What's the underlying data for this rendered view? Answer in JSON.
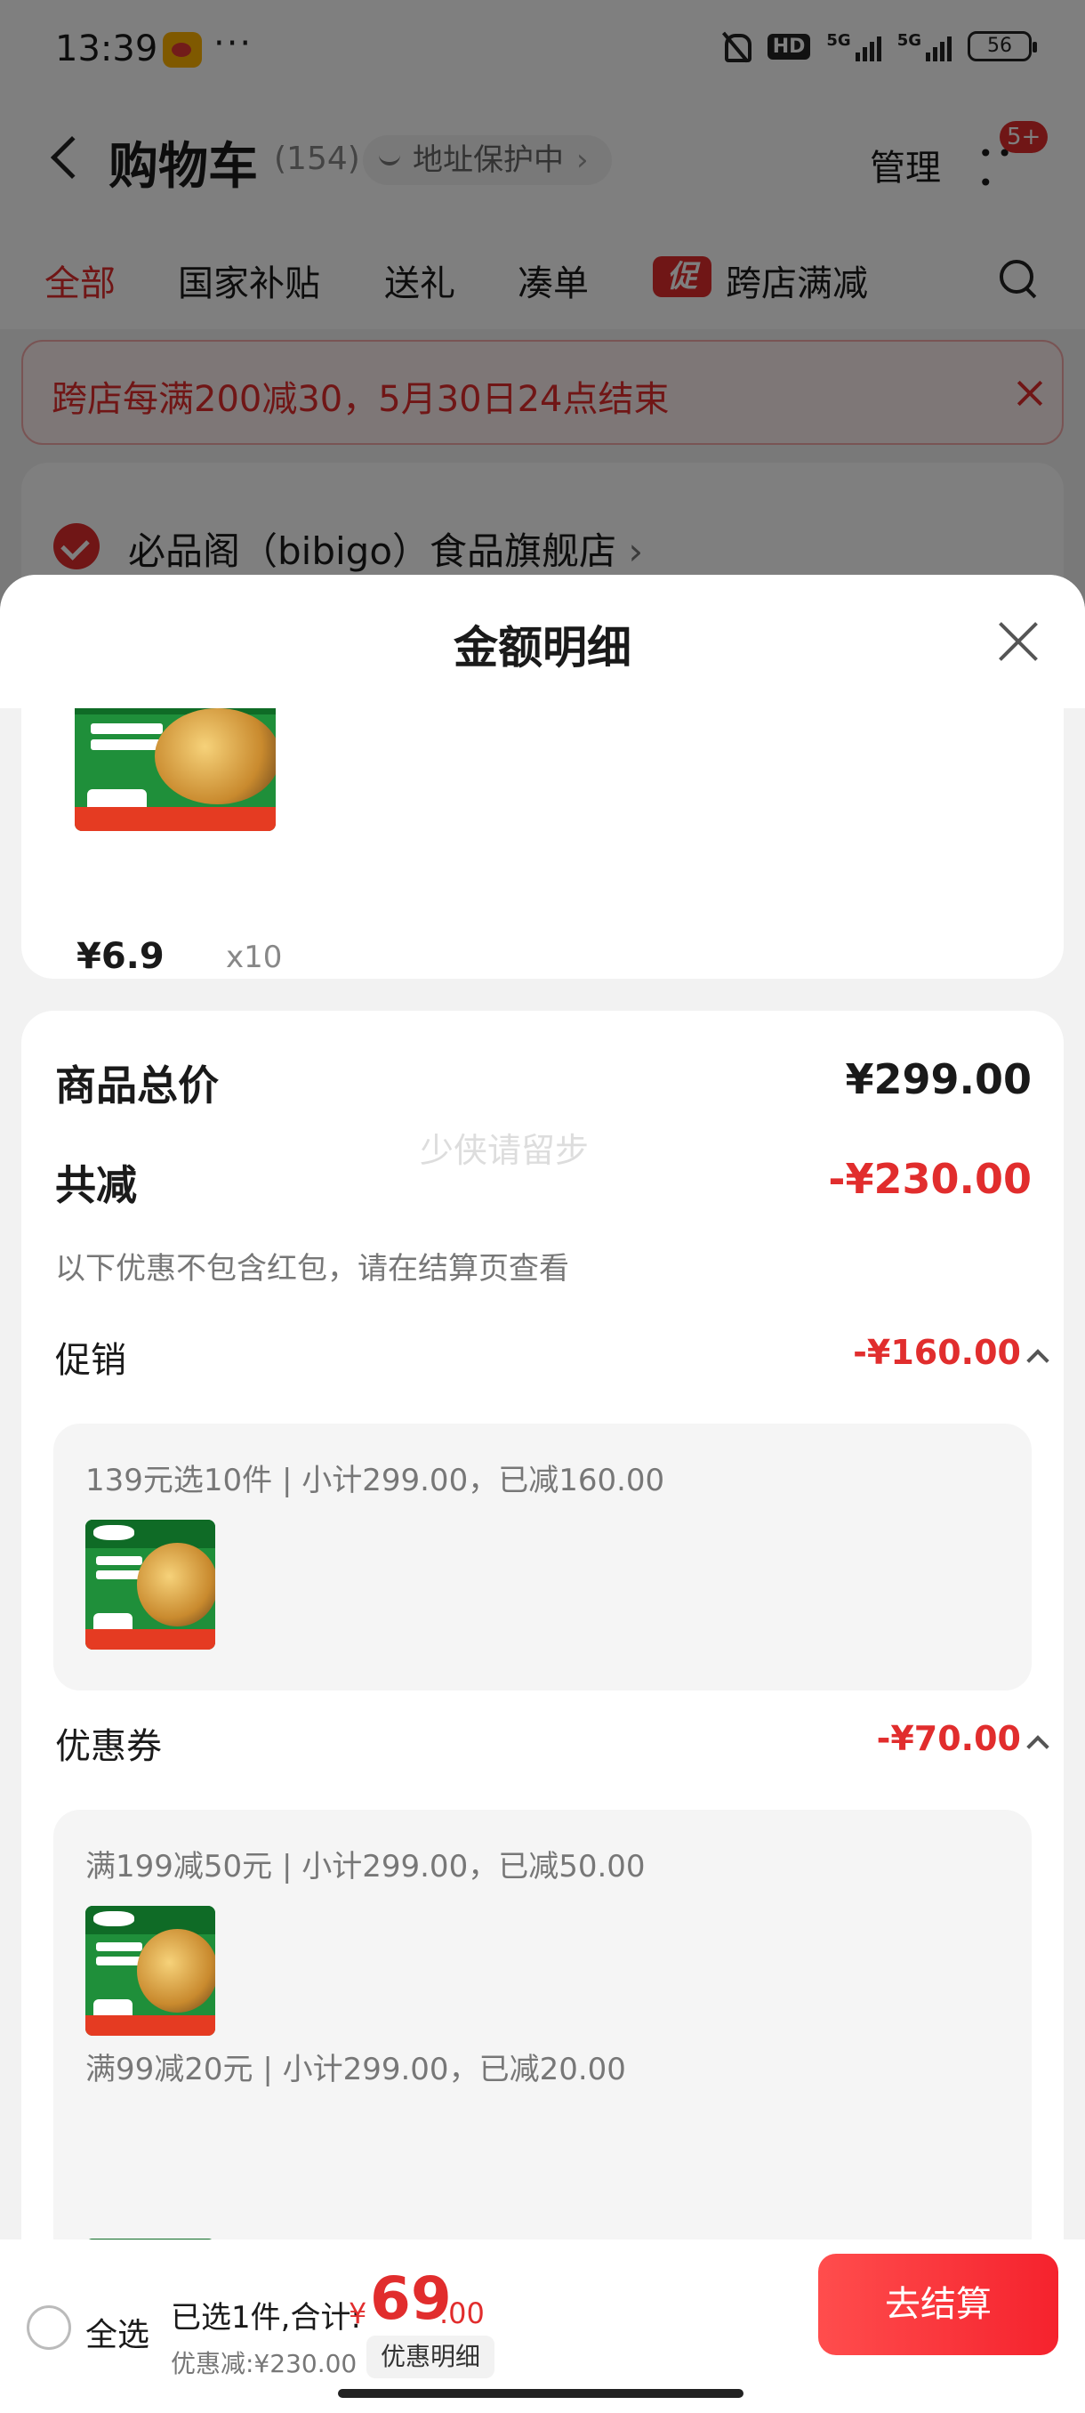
{
  "status_bar": {
    "time": "13:39",
    "dots": "···",
    "hd": "HD",
    "network_1": "5G",
    "network_2": "5G",
    "battery": "56"
  },
  "header": {
    "title": "购物车",
    "count": "(154)",
    "address_pill": "地址保护中",
    "manage_label": "管理",
    "badge": "5+"
  },
  "tabs": [
    {
      "label": "全部",
      "active": true
    },
    {
      "label": "国家补贴"
    },
    {
      "label": "送礼"
    },
    {
      "label": "凑单"
    },
    {
      "label": "跨店满减",
      "tag": "促"
    }
  ],
  "notice": {
    "text": "跨店每满200减30，5月30日24点结束"
  },
  "store": {
    "name": "必品阁（bibigo）食品旗舰店"
  },
  "sheet": {
    "title": "金额明细",
    "product": {
      "price": "¥6.9",
      "quantity": "x10"
    },
    "summary": {
      "total_label": "商品总价",
      "total_value": "¥299.00",
      "reduction_label": "共减",
      "reduction_value": "-¥230.00",
      "note": "以下优惠不包含红包，请在结算页查看",
      "watermark": "少侠请留步"
    },
    "promotion": {
      "label": "促销",
      "value": "-¥160.00",
      "detail": "139元选10件 | 小计299.00，已减160.00"
    },
    "coupon": {
      "label": "优惠券",
      "value": "-¥70.00",
      "details": [
        "满199减50元 | 小计299.00，已减50.00",
        "满99减20元 | 小计299.00，已减20.00"
      ]
    }
  },
  "checkout": {
    "select_all": "全选",
    "selected_text": "已选1件,合计:",
    "currency": "¥",
    "total_integer": "69",
    "total_decimal": ".00",
    "discount_text": "优惠减:¥230.00",
    "detail_button": "优惠明细",
    "checkout_button": "去结算"
  },
  "colors": {
    "accent_red": "#e12d2d",
    "product_green": "#1f8f3a"
  }
}
